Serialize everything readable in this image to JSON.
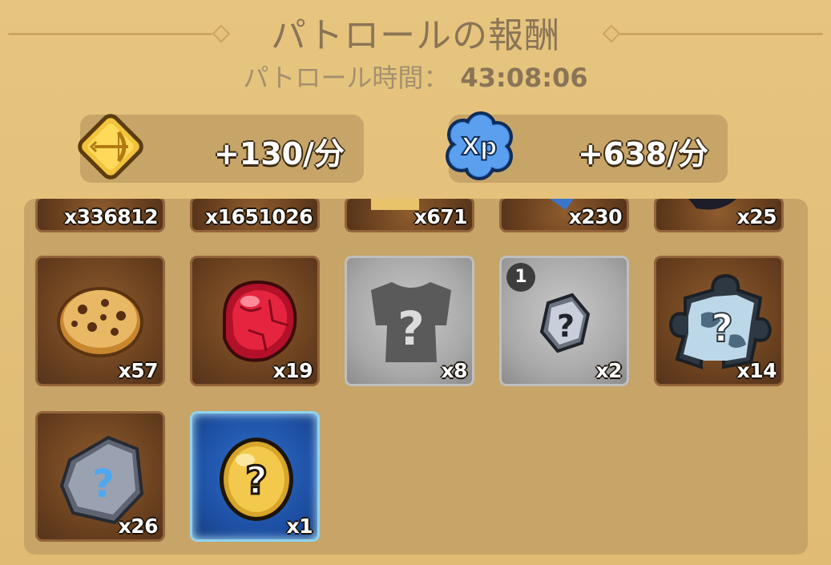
{
  "header": {
    "title": "パトロールの報酬",
    "duration_label": "パトロール時間：",
    "duration_value": "43:08:06"
  },
  "rates": {
    "gold": {
      "icon": "bow-gold-icon",
      "value": "+130/分"
    },
    "xp": {
      "icon": "xp-cloud-icon",
      "value": "+638/分"
    }
  },
  "rewards_row_partial": [
    {
      "name": "item-1",
      "qty": "x336812"
    },
    {
      "name": "item-2",
      "qty": "x1651026"
    },
    {
      "name": "item-3",
      "qty": "x671"
    },
    {
      "name": "item-4",
      "qty": "x230"
    },
    {
      "name": "item-5",
      "qty": "x25"
    }
  ],
  "rewards_row_2": [
    {
      "name": "cookie",
      "icon": "cookie-icon",
      "qty": "x57"
    },
    {
      "name": "red-gem",
      "icon": "red-gem-icon",
      "qty": "x19"
    },
    {
      "name": "mystery-armor",
      "icon": "mystery-armor-icon",
      "qty": "x8"
    },
    {
      "name": "mystery-rune",
      "icon": "mystery-rune-icon",
      "qty": "x2",
      "badge": "1"
    },
    {
      "name": "mystery-puzzle",
      "icon": "mystery-puzzle-icon",
      "qty": "x14"
    }
  ],
  "rewards_row_3": [
    {
      "name": "mystery-stone",
      "icon": "mystery-stone-icon",
      "qty": "x26"
    },
    {
      "name": "mystery-egg",
      "icon": "mystery-egg-icon",
      "qty": "x1"
    }
  ]
}
